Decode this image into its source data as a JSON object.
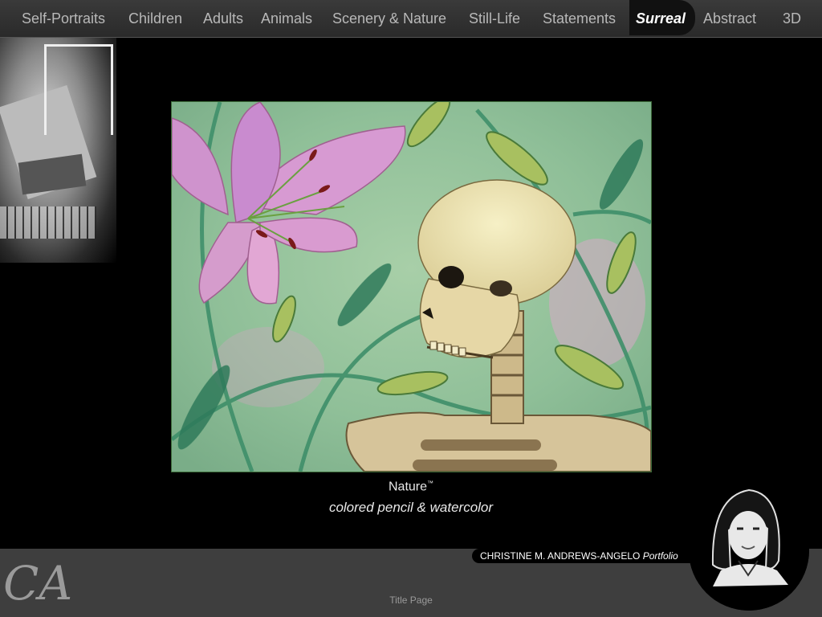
{
  "nav": {
    "items": [
      {
        "label": "Self-Portraits",
        "active": false
      },
      {
        "label": "Children",
        "active": false
      },
      {
        "label": "Adults",
        "active": false
      },
      {
        "label": "Animals",
        "active": false
      },
      {
        "label": "Scenery & Nature",
        "active": false
      },
      {
        "label": "Still-Life",
        "active": false
      },
      {
        "label": "Statements",
        "active": false
      },
      {
        "label": "Surreal",
        "active": true
      },
      {
        "label": "Abstract",
        "active": false
      },
      {
        "label": "3D",
        "active": false
      }
    ]
  },
  "artwork": {
    "title": "Nature",
    "title_mark": "™",
    "medium": "colored pencil & watercolor"
  },
  "footer": {
    "monogram": "CA",
    "name": "CHRISTINE M. ANDREWS-ANGELO",
    "portfolio_label": "Portfolio",
    "title_page_link": "Title Page"
  },
  "colors": {
    "background": "#000000",
    "nav_bar": "#333333",
    "footer_bar": "#3e3e3e",
    "nav_text": "#b8b8b8",
    "active_text": "#ffffff"
  }
}
